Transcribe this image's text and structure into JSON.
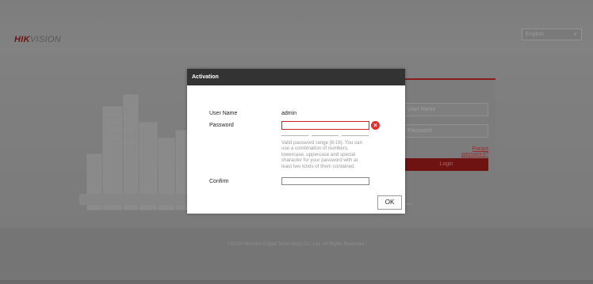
{
  "header": {
    "logo_brand": "HIK",
    "logo_rest": "VISION",
    "language_value": "English",
    "language_icon": "chevron-down-icon"
  },
  "login": {
    "username_placeholder": "User Name",
    "password_placeholder": "Password",
    "forgot_password": "Forgot password?",
    "login_button": "Login"
  },
  "footer": {
    "copyright": "©2019 Hikvision Digital Technology Co., Ltd. All Rights Reserved."
  },
  "activation": {
    "title": "Activation",
    "username_label": "User Name",
    "username_value": "admin",
    "password_label": "Password",
    "password_value": "",
    "error_icon": "error-x-icon",
    "hint": "Valid password range [8-16]. You can use a combination of numbers, lowercase, uppercase and special character for your password with at least two kinds of them contained.",
    "confirm_label": "Confirm",
    "confirm_value": "",
    "ok_button": "OK"
  },
  "colors": {
    "brand_red": "#8a1c1c",
    "error_red": "#cc1f1f",
    "header_dark": "#333333"
  }
}
